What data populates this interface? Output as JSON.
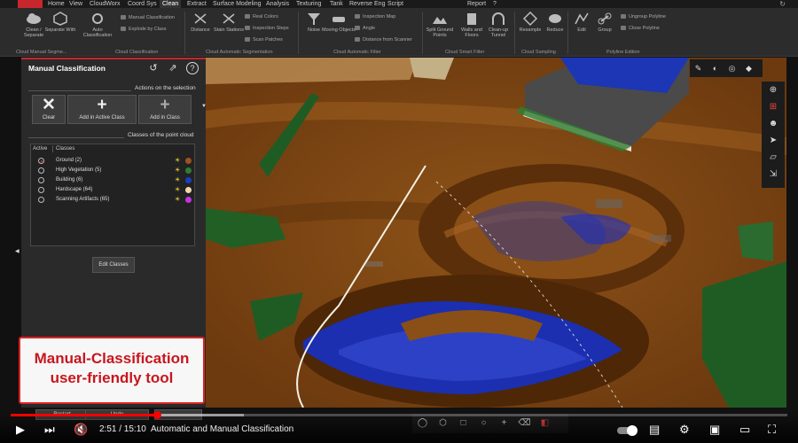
{
  "menu": {
    "items": [
      "Home",
      "View",
      "CloudWorx",
      "Coord Sys",
      "Clean",
      "Extract",
      "Surface Modeling",
      "Analysis",
      "Texturing",
      "Tank",
      "Reverse Eng",
      "Script",
      "Report",
      "?"
    ],
    "active": "Clean"
  },
  "ribbon": {
    "buttons": [
      "Clean / Separate",
      "Separate With",
      "Auto Classification",
      "Distance",
      "Stain Stations",
      "Noise",
      "Moving Objects",
      "Split Ground Points",
      "Walls and Floors",
      "Clean-up Tunnel",
      "Resample",
      "Reduce",
      "Edit",
      "Group"
    ],
    "small": [
      "Manual Classification",
      "Explode by Class",
      "Real Colors",
      "Inspection Steps",
      "Scan Patches",
      "Inspection Map",
      "Angle",
      "Distance from Scanner",
      "Ungroup Polyline",
      "Close Polyline"
    ],
    "groups": [
      "Cloud Manual Segme...",
      "Cloud Classification",
      "Cloud Automatic Segmentation",
      "Cloud Automatic Filter",
      "Cloud Smart Filter",
      "Cloud Sampling",
      "Polyline Edition"
    ]
  },
  "panel": {
    "title": "Manual Classification",
    "actions_title": "Actions on the selection",
    "clear_label": "Clear",
    "add_active_label": "Add in Active Class",
    "add_class_label": "Add in Class",
    "classes_title": "Classes of the point cloud",
    "col_active": "Active",
    "col_classes": "Classes",
    "classes": [
      {
        "name": "Ground (2)",
        "active": true,
        "color": "#a0521c"
      },
      {
        "name": "High Vegetation (5)",
        "active": false,
        "color": "#2e7d32"
      },
      {
        "name": "Building (6)",
        "active": false,
        "color": "#1a3fc4"
      },
      {
        "name": "Hardscape (64)",
        "active": false,
        "color": "#f2d7a8"
      },
      {
        "name": "Scanning Artifacts (65)",
        "active": false,
        "color": "#c433e0"
      }
    ],
    "edit_label": "Edit Classes"
  },
  "overlay": {
    "line1": "Manual-Classification",
    "line2": "user-friendly tool"
  },
  "ghost": {
    "restart": "Restart",
    "undo": "Undo"
  },
  "player": {
    "time": "2:51 / 15:10",
    "title": "Automatic and Manual Classification",
    "progress": 0.188,
    "buffered": 0.3
  },
  "colors": {
    "accent": "#c8262d",
    "ground": "#a0521c",
    "vegetation": "#2e7d32",
    "building": "#1a3fc4"
  }
}
